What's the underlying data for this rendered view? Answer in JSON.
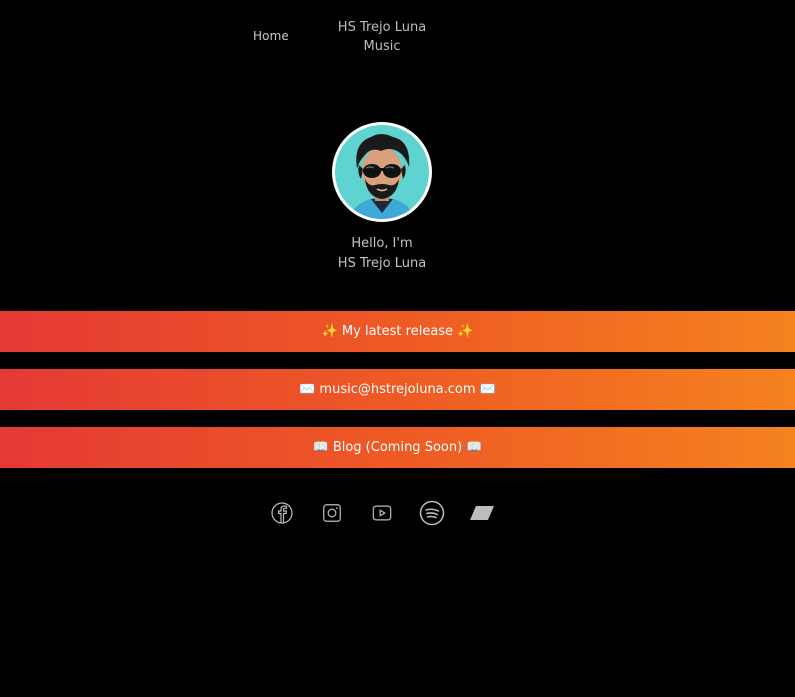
{
  "nav": {
    "home_label": "Home",
    "site_title": "HS Trejo Luna Music"
  },
  "profile": {
    "greeting_line1": "Hello, I'm",
    "greeting_line2": "HS Trejo Luna"
  },
  "links": [
    {
      "label": "✨ My latest release ✨"
    },
    {
      "label": "✉️ music@hstrejoluna.com ✉️"
    },
    {
      "label": "📖 Blog (Coming Soon) 📖"
    }
  ],
  "socials": [
    {
      "icon": "facebook-icon"
    },
    {
      "icon": "instagram-icon"
    },
    {
      "icon": "youtube-icon"
    },
    {
      "icon": "spotify-icon"
    },
    {
      "icon": "bandcamp-icon"
    }
  ],
  "colors": {
    "background": "#000000",
    "gradient_start": "#e53935",
    "gradient_end": "#f5821f",
    "text_muted": "#bdbdbd"
  }
}
